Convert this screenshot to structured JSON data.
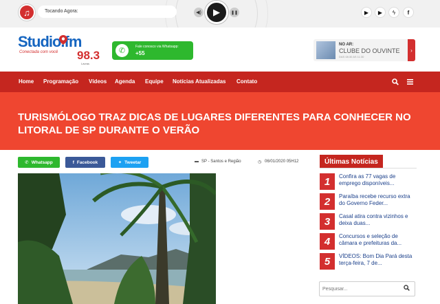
{
  "player": {
    "now_playing_label": "Tocando Agora:",
    "music_icon": "music-icon",
    "volume_icon": "volume-icon",
    "play_icon": "play-icon",
    "stop_icon": "pause-icon"
  },
  "top_social": [
    {
      "name": "youtube-icon",
      "glyph": "▶"
    },
    {
      "name": "play-circle-icon",
      "glyph": "▶"
    },
    {
      "name": "bolt-icon",
      "glyph": "ϟ"
    },
    {
      "name": "facebook-icon",
      "glyph": "f"
    }
  ],
  "logo": {
    "name": "Studio.fm",
    "tagline": "Conectada com você",
    "frequency": "98.3",
    "city": "Lavras"
  },
  "whatsapp_box": {
    "line1": "Fale conosco via Whatsapp:",
    "line2": "+55"
  },
  "on_air": {
    "label": "NO AR:",
    "program": "CLUBE DO OUVINTE",
    "time": "DAS 08:30 AS 11:30",
    "arrow": "›"
  },
  "nav": {
    "items": [
      "Home",
      "Programação",
      "Vídeos",
      "Agenda",
      "Equipe",
      "Notícias Atualizadas",
      "Contato"
    ],
    "search_icon": "🔍",
    "menu_icon": "☰"
  },
  "article": {
    "title": "TURISMÓLOGO TRAZ DICAS DE LUGARES DIFERENTES PARA CONHECER NO LITORAL DE SP DURANTE O VERÃO",
    "share": {
      "whatsapp": "Whatsapp",
      "facebook": "Facebook",
      "twitter": "Tweetar"
    },
    "category": "SP - Santos e Região",
    "date": "06/01/2020 05H12"
  },
  "sidebar": {
    "title": "Últimas Notícias",
    "news": [
      {
        "num": "1",
        "text": "Confira as 77 vagas de emprego disponíveis..."
      },
      {
        "num": "2",
        "text": "Paraíba recebe recurso extra do Governo Feder..."
      },
      {
        "num": "3",
        "text": "Casal atira contra vizinhos e deixa duas..."
      },
      {
        "num": "4",
        "text": "Concursos e seleção de câmara e prefeituras da..."
      },
      {
        "num": "5",
        "text": "VÍDEOS: Bom Dia Pará desta terça-feira, 7 de..."
      }
    ],
    "search_placeholder": "Pesquisar..."
  },
  "colors": {
    "nav_red": "#c5261f",
    "title_band": "#ef4630",
    "whatsapp_green": "#2eb82e",
    "facebook_blue": "#3b5998",
    "twitter_blue": "#1da1f2",
    "link_blue": "#1a3f8a"
  }
}
